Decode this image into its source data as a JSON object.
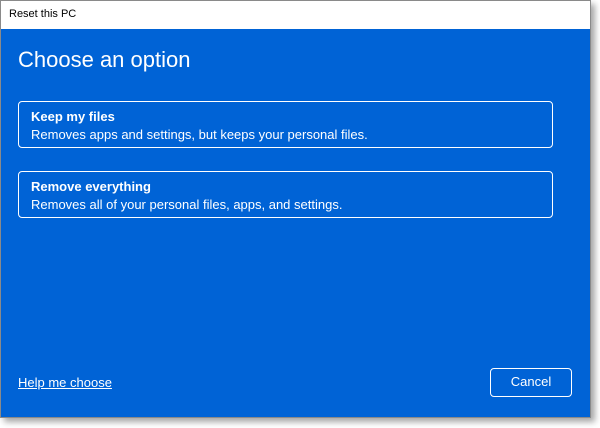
{
  "window": {
    "title": "Reset this PC"
  },
  "main": {
    "heading": "Choose an option",
    "options": [
      {
        "title": "Keep my files",
        "description": "Removes apps and settings, but keeps your personal files."
      },
      {
        "title": "Remove everything",
        "description": "Removes all of your personal files, apps, and settings."
      }
    ]
  },
  "footer": {
    "help_link": "Help me choose",
    "cancel_label": "Cancel"
  },
  "colors": {
    "background": "#0063d6",
    "text": "#ffffff",
    "titlebar": "#ffffff"
  }
}
